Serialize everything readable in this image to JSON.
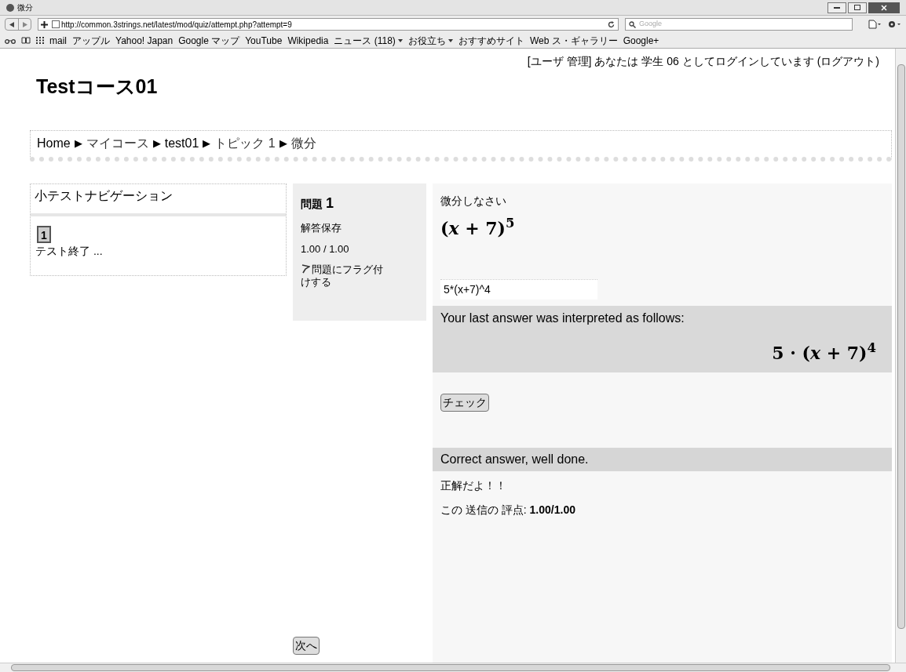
{
  "window": {
    "title": "微分"
  },
  "toolbar": {
    "url": "http://common.3strings.net/latest/mod/quiz/attempt.php?attempt=9",
    "search_placeholder": "Google"
  },
  "bookmarks": [
    {
      "label": "mail",
      "dropdown": false
    },
    {
      "label": "アップル",
      "dropdown": false
    },
    {
      "label": "Yahoo! Japan",
      "dropdown": false
    },
    {
      "label": "Google マップ",
      "dropdown": false
    },
    {
      "label": "YouTube",
      "dropdown": false
    },
    {
      "label": "Wikipedia",
      "dropdown": false
    },
    {
      "label": "ニュース (118)",
      "dropdown": true
    },
    {
      "label": "お役立ち",
      "dropdown": true
    },
    {
      "label": "おすすめサイト",
      "dropdown": false
    },
    {
      "label": "Web ス・ギャラリー",
      "dropdown": false
    },
    {
      "label": "Google+",
      "dropdown": false
    }
  ],
  "header": {
    "course_title": "Testコース01",
    "user_admin": "[ユーザ 管理]",
    "login_text": "あなたは 学生 06 としてログインしています",
    "logout": "(ログアウト)"
  },
  "breadcrumb": {
    "separator": "▶",
    "items": [
      "Home",
      "マイコース",
      "test01",
      "トピック 1",
      "微分"
    ]
  },
  "quiz_navigation": {
    "title": "小テストナビゲーション",
    "buttons": [
      "1"
    ],
    "finish_link": "テスト終了 ..."
  },
  "question_info": {
    "label": "問題",
    "number": "1",
    "status": "解答保存",
    "grade": "1.00 / 1.00",
    "flag_link": "問題にフラグ付けする"
  },
  "question": {
    "prompt": "微分しなさい",
    "expression": "(*x* + 7)$^{5}$",
    "answer": "5*(x+7)^4",
    "interpretation_label": "Your last answer was interpreted as follows:",
    "interpretation": "5 · (*x* + 7)$^{4}$",
    "check_button": "チェック",
    "feedback": "Correct answer, well done.",
    "feedback_comment": "正解だよ！！",
    "score": "この 送信の 評点: **1.00/1.00**"
  },
  "next_button": "次へ"
}
